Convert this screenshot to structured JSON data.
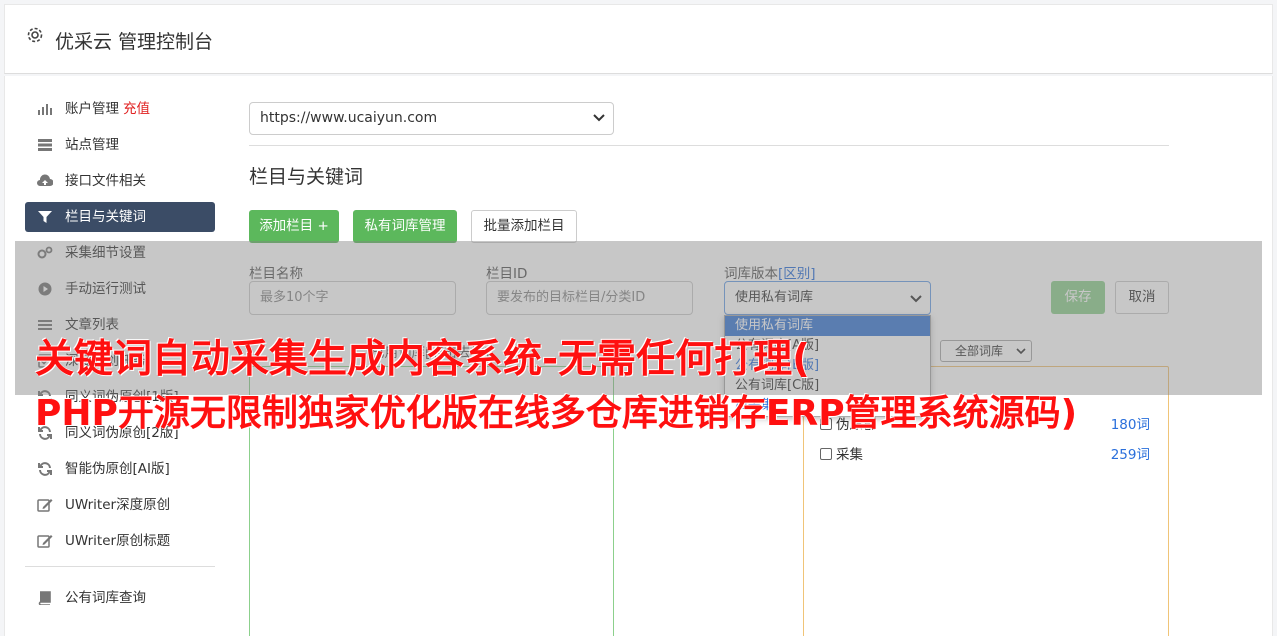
{
  "header": {
    "title": "优采云 管理控制台",
    "icon": "gear-icon"
  },
  "sidebar": {
    "items": [
      {
        "label": "账户管理",
        "extra": "充值",
        "icon": "bar-chart-icon"
      },
      {
        "label": "站点管理",
        "icon": "server-icon"
      },
      {
        "label": "接口文件相关",
        "icon": "cloud-upload-icon"
      },
      {
        "label": "栏目与关键词",
        "icon": "filter-icon",
        "active": true
      },
      {
        "label": "采集细节设置",
        "icon": "gears-icon"
      },
      {
        "label": "手动运行测试",
        "icon": "play-circle-icon"
      },
      {
        "label": "文章列表",
        "icon": "list-icon"
      },
      {
        "label": "深度原创任务",
        "icon": "task-icon"
      },
      {
        "label": "同义词伪原创[1版]",
        "icon": "refresh-icon"
      },
      {
        "label": "同义词伪原创[2版]",
        "icon": "refresh-icon"
      },
      {
        "label": "智能伪原创[AI版]",
        "icon": "refresh-icon"
      },
      {
        "label": "UWriter深度原创",
        "icon": "edit-icon"
      },
      {
        "label": "UWriter原创标题",
        "icon": "edit-icon"
      },
      {
        "label": "公有词库查询",
        "icon": "book-icon"
      }
    ]
  },
  "main": {
    "site_select": {
      "value": "https://www.ucaiyun.com"
    },
    "section_title": "栏目与关键词",
    "buttons": {
      "add_column": "添加栏目 +",
      "private_lib": "私有词库管理",
      "batch_add": "批量添加栏目"
    },
    "form": {
      "column_name_label": "栏目名称",
      "column_name_placeholder": "最多10个字",
      "column_id_label": "栏目ID",
      "column_id_placeholder": "要发布的目标栏目/分类ID",
      "lib_version_label": "词库版本",
      "lib_version_link": "[区别]",
      "lib_version_value": "使用私有词库",
      "save": "保存",
      "cancel": "取消"
    },
    "lib_version_options": [
      "使用私有词库",
      "公有词库[A版]",
      "公有词库[B版]",
      "公有词库[C版]",
      "AI采集"
    ],
    "left_box_caption": "已用词库[点击去掉]",
    "all_libs_select": "全部词库",
    "lib_list": [
      {
        "name": "伪原创",
        "count": "180词"
      },
      {
        "name": "采集",
        "count": "259词"
      }
    ]
  },
  "banner": {
    "line1": "关键词自动采集生成内容系统-无需任何打理(",
    "line2": "PHP开源无限制独家优化版在线多仓库进销存ERP管理系统源码)"
  }
}
